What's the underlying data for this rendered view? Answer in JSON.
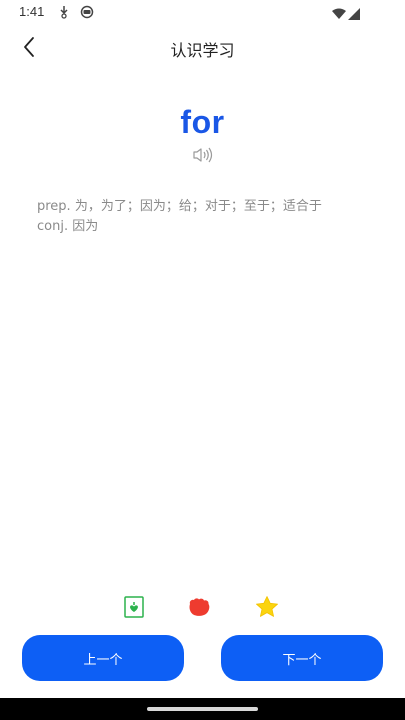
{
  "status_bar": {
    "time": "1:41",
    "icons": [
      "download-icon",
      "sync-icon",
      "wifi-icon",
      "signal-icon"
    ]
  },
  "header": {
    "title": "认识学习",
    "back_icon": "chevron-left-icon"
  },
  "word": {
    "text": "for",
    "color": "#1a57e6",
    "speaker_icon": "speaker-icon"
  },
  "definitions": [
    "prep. 为，为了；因为；给；对于；至于；适合于",
    "conj. 因为"
  ],
  "actions": {
    "icons": [
      "green-card-icon",
      "red-hand-icon",
      "yellow-star-icon"
    ],
    "colors": {
      "green": "#2bb24c",
      "red": "#ee3b2f",
      "yellow": "#fbd40f"
    }
  },
  "navigation": {
    "prev_label": "上一个",
    "next_label": "下一个",
    "button_color": "#0d5ff5"
  }
}
